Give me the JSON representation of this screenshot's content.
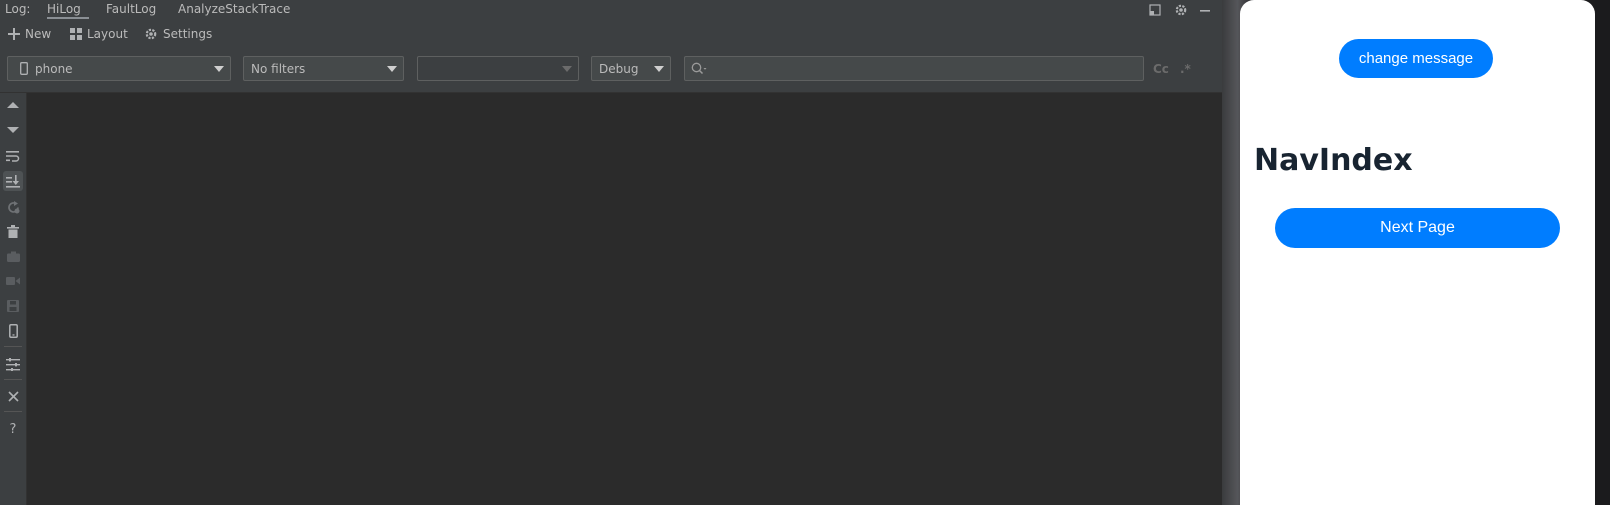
{
  "log_panel": {
    "label": "Log:",
    "tabs": [
      "HiLog",
      "FaultLog",
      "AnalyzeStackTrace"
    ],
    "active_tab": "HiLog"
  },
  "toolbar": {
    "new_label": "New",
    "layout_label": "Layout",
    "settings_label": "Settings"
  },
  "filters": {
    "device": "phone",
    "filter": "No filters",
    "process": "",
    "level": "Debug",
    "search_value": "",
    "case_label": "Cc",
    "regex_label": ".*"
  },
  "side_tools": [
    "scroll-up",
    "scroll-down",
    "soft-wrap",
    "scroll-to-end",
    "restart",
    "clear",
    "screenshot",
    "record",
    "save",
    "device",
    "filter-settings",
    "close",
    "help"
  ],
  "preview": {
    "change_button": "change message",
    "title": "NavIndex",
    "next_button": "Next Page"
  },
  "colors": {
    "accent": "#007dff",
    "ide_bg": "#2b2b2b",
    "panel_bg": "#3c3f41",
    "title_text": "#182431"
  }
}
